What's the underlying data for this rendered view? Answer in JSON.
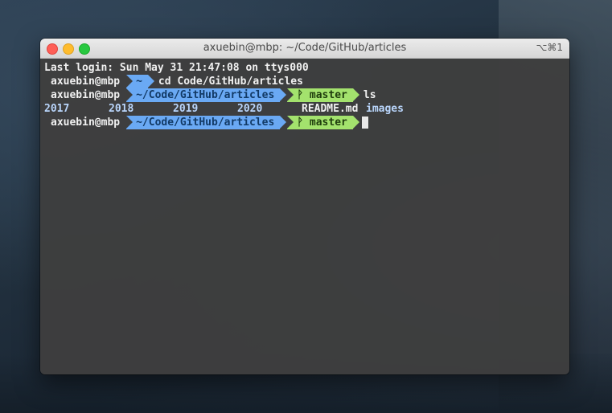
{
  "window": {
    "title": "axuebin@mbp: ~/Code/GitHub/articles",
    "shortcut": "⌥⌘1"
  },
  "terminal": {
    "last_login": "Last login: Sun May 31 21:47:08 on ttys000",
    "prompt1": {
      "user": "axuebin@mbp",
      "dir": "~",
      "command": "cd Code/GitHub/articles"
    },
    "prompt2": {
      "user": "axuebin@mbp",
      "dir": "~/Code/GitHub/articles",
      "branch": "ᚹ master",
      "command": "ls"
    },
    "ls_output": [
      "2017",
      "2018",
      "2019",
      "2020",
      "README.md",
      "images"
    ],
    "prompt3": {
      "user": "axuebin@mbp",
      "dir": "~/Code/GitHub/articles",
      "branch": "ᚹ master"
    }
  },
  "colors": {
    "dir_segment": "#6aa9f4",
    "git_segment": "#a3e26d",
    "terminal_bg": "#3e3e3e",
    "directory_text": "#b9d5fb"
  }
}
